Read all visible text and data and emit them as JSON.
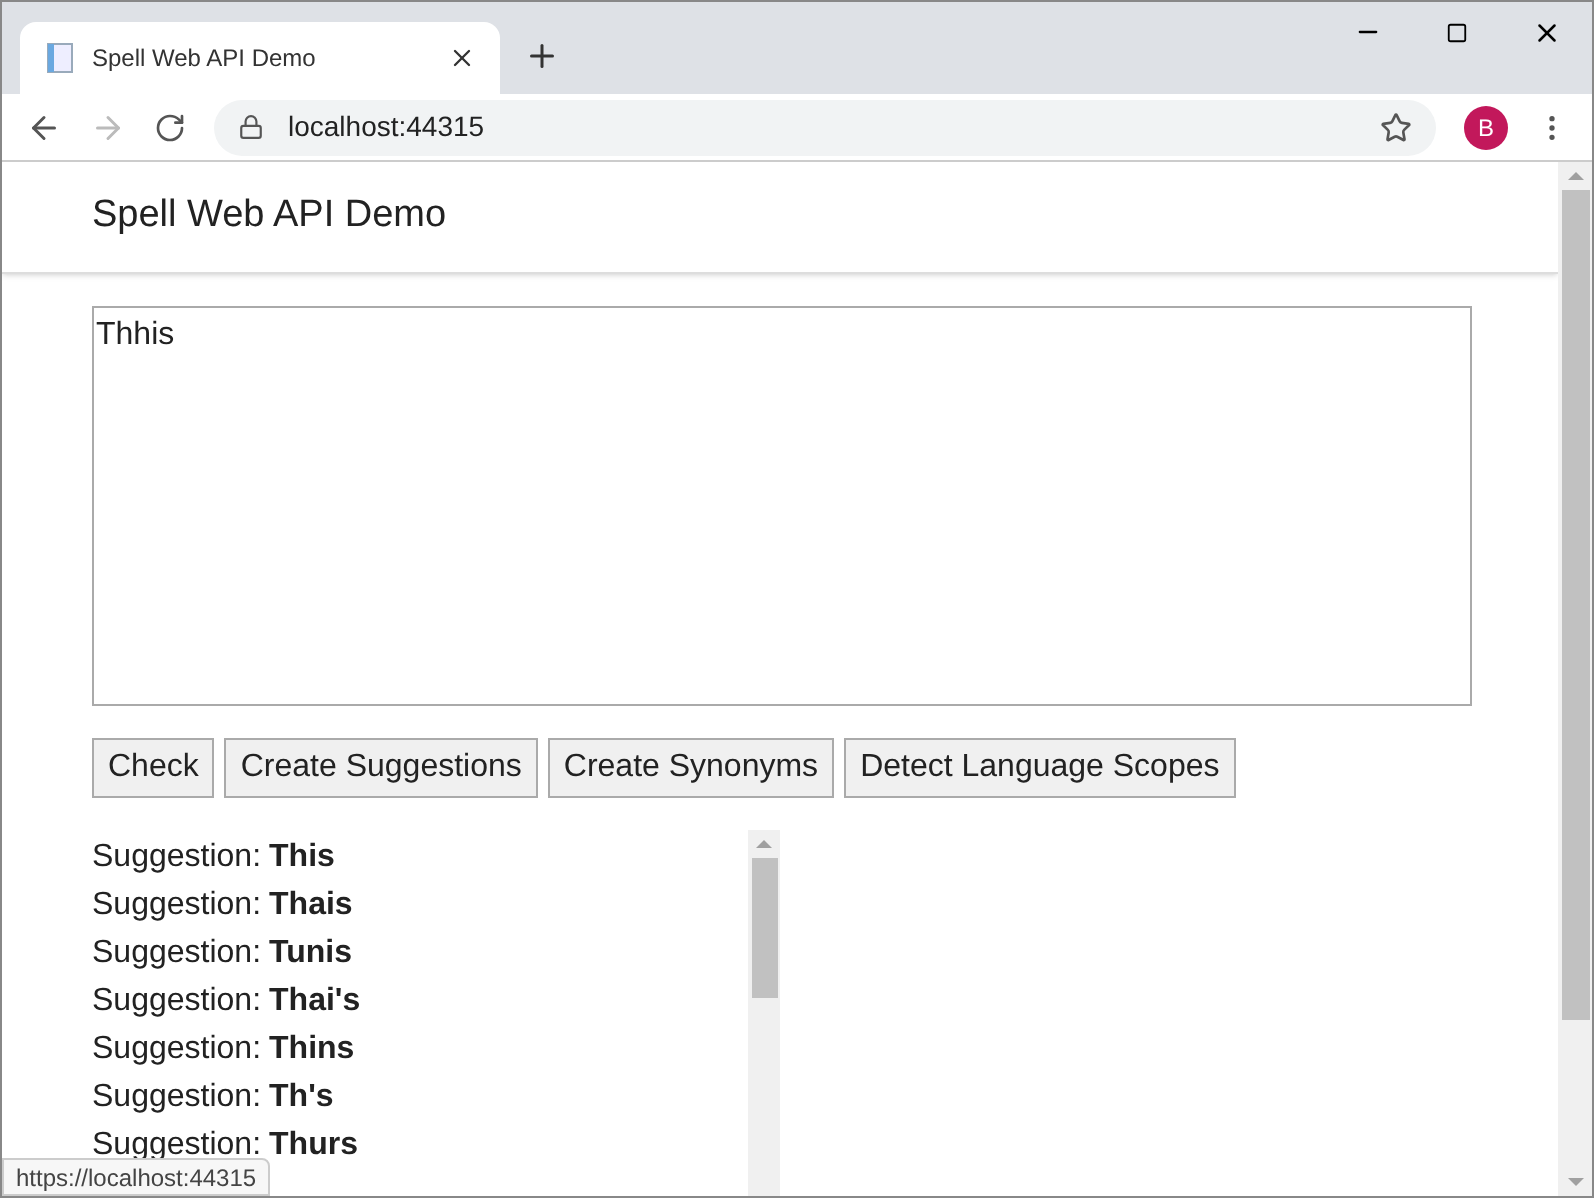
{
  "tab": {
    "title": "Spell Web API Demo"
  },
  "address": "localhost:44315",
  "profile": "B",
  "page": {
    "heading": "Spell Web API Demo",
    "text": "Thhis",
    "buttons": [
      "Check",
      "Create Suggestions",
      "Create Synonyms",
      "Detect Language Scopes"
    ],
    "suggestions": [
      {
        "label": "Suggestion:",
        "word": "This"
      },
      {
        "label": "Suggestion:",
        "word": "Thais"
      },
      {
        "label": "Suggestion:",
        "word": "Tunis"
      },
      {
        "label": "Suggestion:",
        "word": "Thai's"
      },
      {
        "label": "Suggestion:",
        "word": "Thins"
      },
      {
        "label": "Suggestion:",
        "word": "Th's"
      },
      {
        "label": "Suggestion:",
        "word": "Thurs"
      }
    ]
  },
  "status_url": "https://localhost:44315"
}
